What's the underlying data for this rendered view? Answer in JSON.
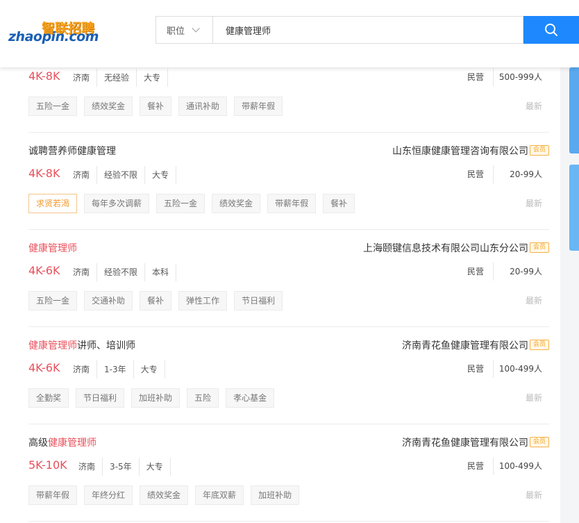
{
  "header": {
    "logo": {
      "cn": "智联招聘",
      "en": "zhaopin.com"
    },
    "search": {
      "type_label": "职位",
      "query": "健康管理师",
      "button_icon": "search-icon"
    }
  },
  "colors": {
    "accent": "#1e88ff",
    "salary": "#e8505b",
    "vip_badge": "#f5a623"
  },
  "jobs": [
    {
      "title_pre": "",
      "title_hl": "",
      "title_post": "",
      "company": "",
      "vip": "",
      "salary": "4K-8K",
      "city": "济南",
      "experience": "无经验",
      "education": "大专",
      "company_type": "民营",
      "company_size": "500-999人",
      "welfare": [
        "五险一金",
        "绩效奖金",
        "餐补",
        "通讯补助",
        "带薪年假"
      ],
      "hot_tag": "",
      "latest": "最新"
    },
    {
      "title_pre": "诚聘营养师健康管理",
      "title_hl": "",
      "title_post": "",
      "company": "山东恒康健康管理咨询有限公司",
      "vip": "会员",
      "salary": "4K-8K",
      "city": "济南",
      "experience": "经验不限",
      "education": "大专",
      "company_type": "民营",
      "company_size": "20-99人",
      "welfare": [
        "每年多次调薪",
        "五险一金",
        "绩效奖金",
        "带薪年假",
        "餐补"
      ],
      "hot_tag": "求贤若渴",
      "latest": "最新"
    },
    {
      "title_pre": "",
      "title_hl": "健康管理师",
      "title_post": "",
      "company": "上海颐键信息技术有限公司山东分公司",
      "vip": "会员",
      "salary": "4K-6K",
      "city": "济南",
      "experience": "经验不限",
      "education": "本科",
      "company_type": "民营",
      "company_size": "20-99人",
      "welfare": [
        "五险一金",
        "交通补助",
        "餐补",
        "弹性工作",
        "节日福利"
      ],
      "hot_tag": "",
      "latest": "最新"
    },
    {
      "title_pre": "",
      "title_hl": "健康管理师",
      "title_post": "讲师、培训师",
      "company": "济南青花鱼健康管理有限公司",
      "vip": "会员",
      "salary": "4K-6K",
      "city": "济南",
      "experience": "1-3年",
      "education": "大专",
      "company_type": "民营",
      "company_size": "100-499人",
      "welfare": [
        "全勤奖",
        "节日福利",
        "加班补助",
        "五险",
        "孝心基金"
      ],
      "hot_tag": "",
      "latest": "最新"
    },
    {
      "title_pre": "高级",
      "title_hl": "健康管理师",
      "title_post": "",
      "company": "济南青花鱼健康管理有限公司",
      "vip": "会员",
      "salary": "5K-10K",
      "city": "济南",
      "experience": "3-5年",
      "education": "大专",
      "company_type": "民营",
      "company_size": "100-499人",
      "welfare": [
        "带薪年假",
        "年终分红",
        "绩效奖金",
        "年底双薪",
        "加班补助"
      ],
      "hot_tag": "",
      "latest": "最新"
    }
  ]
}
